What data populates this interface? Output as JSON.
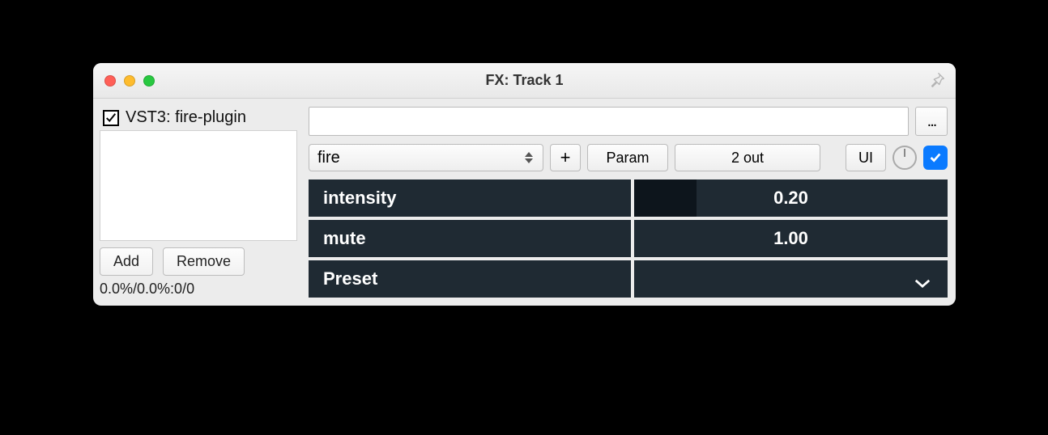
{
  "window": {
    "title": "FX: Track 1"
  },
  "sidebar": {
    "fx_name": "VST3: fire-plugin",
    "fx_enabled": true,
    "add_label": "Add",
    "remove_label": "Remove",
    "status": "0.0%/0.0%:0/0"
  },
  "toolbar": {
    "preset_text": "",
    "ellipsis": "...",
    "combo_value": "fire",
    "plus": "+",
    "param_label": "Param",
    "out_label": "2 out",
    "ui_label": "UI",
    "wet_enabled": true
  },
  "params": [
    {
      "label": "intensity",
      "value_text": "0.20",
      "fill": 0.2
    },
    {
      "label": "mute",
      "value_text": "1.00",
      "fill": 0.0
    }
  ],
  "preset_row": {
    "label": "Preset"
  }
}
